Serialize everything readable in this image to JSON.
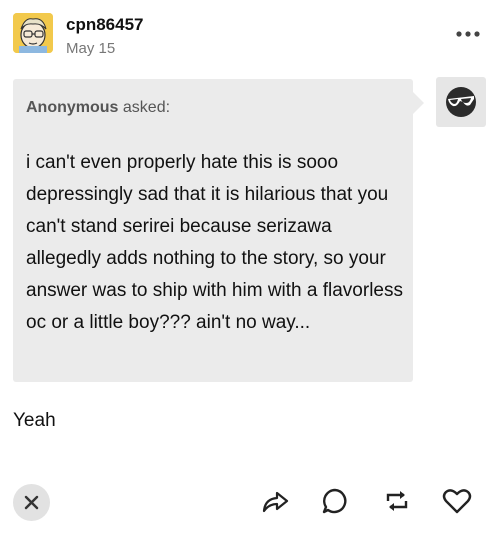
{
  "post": {
    "username": "cpn86457",
    "date": "May 15",
    "asker_name": "Anonymous",
    "asker_suffix": " asked:",
    "question": "i can't even properly hate this is sooo depressingly sad that it is hilarious that you can't stand serirei because serizawa allegedly adds nothing to the story, so your answer was to ship with him with a flavorless oc or a little boy??? ain't no way...",
    "answer": "Yeah"
  },
  "icons": {
    "more": "more-options-icon",
    "close": "close-icon",
    "share": "share-icon",
    "reply": "reply-icon",
    "reblog": "reblog-icon",
    "like": "heart-icon"
  },
  "colors": {
    "ask_bg": "#ebebeb",
    "avatar_bg": "#f2c94c",
    "muted_text": "#777777"
  }
}
